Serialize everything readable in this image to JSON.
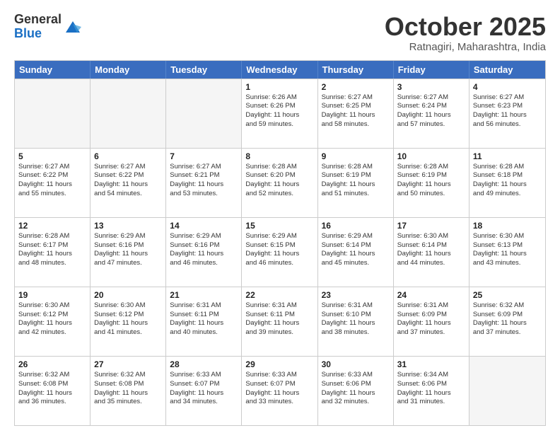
{
  "header": {
    "logo": {
      "line1": "General",
      "line2": "Blue"
    },
    "title": "October 2025",
    "subtitle": "Ratnagiri, Maharashtra, India"
  },
  "days": [
    "Sunday",
    "Monday",
    "Tuesday",
    "Wednesday",
    "Thursday",
    "Friday",
    "Saturday"
  ],
  "weeks": [
    [
      {
        "day": "",
        "lines": []
      },
      {
        "day": "",
        "lines": []
      },
      {
        "day": "",
        "lines": []
      },
      {
        "day": "1",
        "lines": [
          "Sunrise: 6:26 AM",
          "Sunset: 6:26 PM",
          "Daylight: 11 hours",
          "and 59 minutes."
        ]
      },
      {
        "day": "2",
        "lines": [
          "Sunrise: 6:27 AM",
          "Sunset: 6:25 PM",
          "Daylight: 11 hours",
          "and 58 minutes."
        ]
      },
      {
        "day": "3",
        "lines": [
          "Sunrise: 6:27 AM",
          "Sunset: 6:24 PM",
          "Daylight: 11 hours",
          "and 57 minutes."
        ]
      },
      {
        "day": "4",
        "lines": [
          "Sunrise: 6:27 AM",
          "Sunset: 6:23 PM",
          "Daylight: 11 hours",
          "and 56 minutes."
        ]
      }
    ],
    [
      {
        "day": "5",
        "lines": [
          "Sunrise: 6:27 AM",
          "Sunset: 6:22 PM",
          "Daylight: 11 hours",
          "and 55 minutes."
        ]
      },
      {
        "day": "6",
        "lines": [
          "Sunrise: 6:27 AM",
          "Sunset: 6:22 PM",
          "Daylight: 11 hours",
          "and 54 minutes."
        ]
      },
      {
        "day": "7",
        "lines": [
          "Sunrise: 6:27 AM",
          "Sunset: 6:21 PM",
          "Daylight: 11 hours",
          "and 53 minutes."
        ]
      },
      {
        "day": "8",
        "lines": [
          "Sunrise: 6:28 AM",
          "Sunset: 6:20 PM",
          "Daylight: 11 hours",
          "and 52 minutes."
        ]
      },
      {
        "day": "9",
        "lines": [
          "Sunrise: 6:28 AM",
          "Sunset: 6:19 PM",
          "Daylight: 11 hours",
          "and 51 minutes."
        ]
      },
      {
        "day": "10",
        "lines": [
          "Sunrise: 6:28 AM",
          "Sunset: 6:19 PM",
          "Daylight: 11 hours",
          "and 50 minutes."
        ]
      },
      {
        "day": "11",
        "lines": [
          "Sunrise: 6:28 AM",
          "Sunset: 6:18 PM",
          "Daylight: 11 hours",
          "and 49 minutes."
        ]
      }
    ],
    [
      {
        "day": "12",
        "lines": [
          "Sunrise: 6:28 AM",
          "Sunset: 6:17 PM",
          "Daylight: 11 hours",
          "and 48 minutes."
        ]
      },
      {
        "day": "13",
        "lines": [
          "Sunrise: 6:29 AM",
          "Sunset: 6:16 PM",
          "Daylight: 11 hours",
          "and 47 minutes."
        ]
      },
      {
        "day": "14",
        "lines": [
          "Sunrise: 6:29 AM",
          "Sunset: 6:16 PM",
          "Daylight: 11 hours",
          "and 46 minutes."
        ]
      },
      {
        "day": "15",
        "lines": [
          "Sunrise: 6:29 AM",
          "Sunset: 6:15 PM",
          "Daylight: 11 hours",
          "and 46 minutes."
        ]
      },
      {
        "day": "16",
        "lines": [
          "Sunrise: 6:29 AM",
          "Sunset: 6:14 PM",
          "Daylight: 11 hours",
          "and 45 minutes."
        ]
      },
      {
        "day": "17",
        "lines": [
          "Sunrise: 6:30 AM",
          "Sunset: 6:14 PM",
          "Daylight: 11 hours",
          "and 44 minutes."
        ]
      },
      {
        "day": "18",
        "lines": [
          "Sunrise: 6:30 AM",
          "Sunset: 6:13 PM",
          "Daylight: 11 hours",
          "and 43 minutes."
        ]
      }
    ],
    [
      {
        "day": "19",
        "lines": [
          "Sunrise: 6:30 AM",
          "Sunset: 6:12 PM",
          "Daylight: 11 hours",
          "and 42 minutes."
        ]
      },
      {
        "day": "20",
        "lines": [
          "Sunrise: 6:30 AM",
          "Sunset: 6:12 PM",
          "Daylight: 11 hours",
          "and 41 minutes."
        ]
      },
      {
        "day": "21",
        "lines": [
          "Sunrise: 6:31 AM",
          "Sunset: 6:11 PM",
          "Daylight: 11 hours",
          "and 40 minutes."
        ]
      },
      {
        "day": "22",
        "lines": [
          "Sunrise: 6:31 AM",
          "Sunset: 6:11 PM",
          "Daylight: 11 hours",
          "and 39 minutes."
        ]
      },
      {
        "day": "23",
        "lines": [
          "Sunrise: 6:31 AM",
          "Sunset: 6:10 PM",
          "Daylight: 11 hours",
          "and 38 minutes."
        ]
      },
      {
        "day": "24",
        "lines": [
          "Sunrise: 6:31 AM",
          "Sunset: 6:09 PM",
          "Daylight: 11 hours",
          "and 37 minutes."
        ]
      },
      {
        "day": "25",
        "lines": [
          "Sunrise: 6:32 AM",
          "Sunset: 6:09 PM",
          "Daylight: 11 hours",
          "and 37 minutes."
        ]
      }
    ],
    [
      {
        "day": "26",
        "lines": [
          "Sunrise: 6:32 AM",
          "Sunset: 6:08 PM",
          "Daylight: 11 hours",
          "and 36 minutes."
        ]
      },
      {
        "day": "27",
        "lines": [
          "Sunrise: 6:32 AM",
          "Sunset: 6:08 PM",
          "Daylight: 11 hours",
          "and 35 minutes."
        ]
      },
      {
        "day": "28",
        "lines": [
          "Sunrise: 6:33 AM",
          "Sunset: 6:07 PM",
          "Daylight: 11 hours",
          "and 34 minutes."
        ]
      },
      {
        "day": "29",
        "lines": [
          "Sunrise: 6:33 AM",
          "Sunset: 6:07 PM",
          "Daylight: 11 hours",
          "and 33 minutes."
        ]
      },
      {
        "day": "30",
        "lines": [
          "Sunrise: 6:33 AM",
          "Sunset: 6:06 PM",
          "Daylight: 11 hours",
          "and 32 minutes."
        ]
      },
      {
        "day": "31",
        "lines": [
          "Sunrise: 6:34 AM",
          "Sunset: 6:06 PM",
          "Daylight: 11 hours",
          "and 31 minutes."
        ]
      },
      {
        "day": "",
        "lines": []
      }
    ]
  ]
}
